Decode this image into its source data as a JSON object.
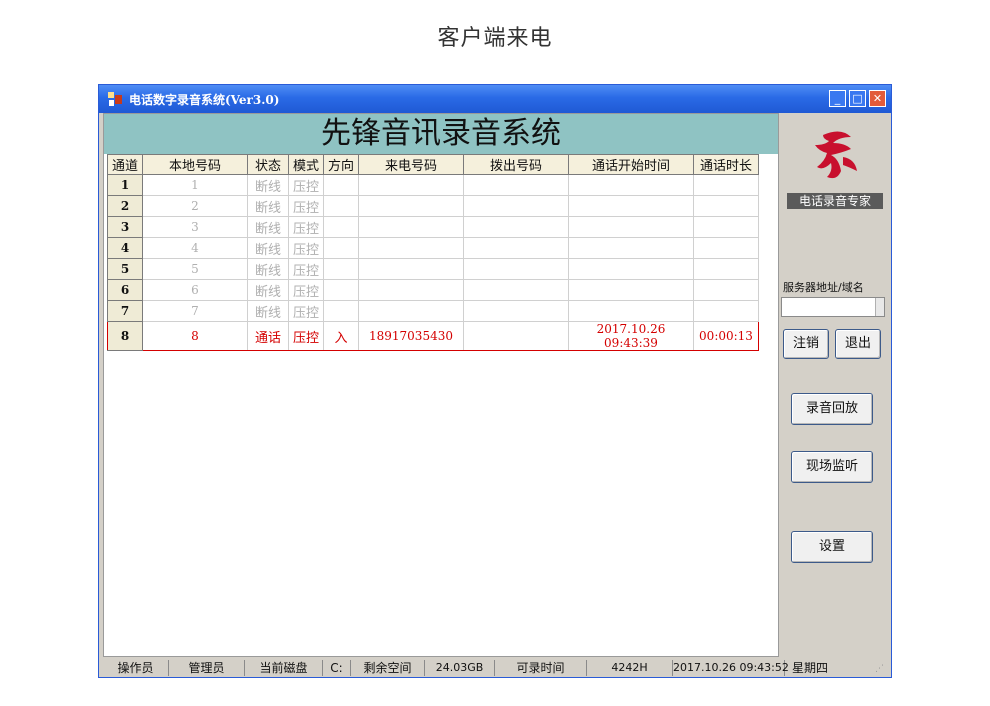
{
  "caption": "客户端来电",
  "window": {
    "title": "电话数字录音系统(Ver3.0)",
    "controls": {
      "minimize": "_",
      "maximize": "□",
      "close": "✕"
    }
  },
  "banner": "先锋音讯录音系统",
  "table": {
    "headers": [
      "通道",
      "本地号码",
      "状态",
      "模式",
      "方向",
      "来电号码",
      "拨出号码",
      "通话开始时间",
      "通话时长"
    ],
    "rows": [
      {
        "channel": "1",
        "local": "1",
        "status": "断线",
        "mode": "压控",
        "direction": "",
        "incoming": "",
        "outgoing": "",
        "start": "",
        "duration": ""
      },
      {
        "channel": "2",
        "local": "2",
        "status": "断线",
        "mode": "压控",
        "direction": "",
        "incoming": "",
        "outgoing": "",
        "start": "",
        "duration": ""
      },
      {
        "channel": "3",
        "local": "3",
        "status": "断线",
        "mode": "压控",
        "direction": "",
        "incoming": "",
        "outgoing": "",
        "start": "",
        "duration": ""
      },
      {
        "channel": "4",
        "local": "4",
        "status": "断线",
        "mode": "压控",
        "direction": "",
        "incoming": "",
        "outgoing": "",
        "start": "",
        "duration": ""
      },
      {
        "channel": "5",
        "local": "5",
        "status": "断线",
        "mode": "压控",
        "direction": "",
        "incoming": "",
        "outgoing": "",
        "start": "",
        "duration": ""
      },
      {
        "channel": "6",
        "local": "6",
        "status": "断线",
        "mode": "压控",
        "direction": "",
        "incoming": "",
        "outgoing": "",
        "start": "",
        "duration": ""
      },
      {
        "channel": "7",
        "local": "7",
        "status": "断线",
        "mode": "压控",
        "direction": "",
        "incoming": "",
        "outgoing": "",
        "start": "",
        "duration": ""
      },
      {
        "channel": "8",
        "local": "8",
        "status": "通话",
        "mode": "压控",
        "direction": "入",
        "incoming": "18917035430",
        "outgoing": "",
        "start": "2017.10.26 09:43:39",
        "duration": "00:00:13"
      }
    ],
    "active_row_color": "#d40000"
  },
  "side": {
    "logo_icon": "red-calligraphy-logo-icon",
    "brand": "电话录音专家",
    "server_label": "服务器地址/域名",
    "server_value": "",
    "logout_label": "注销",
    "exit_label": "退出",
    "playback_label": "录音回放",
    "monitor_label": "现场监听",
    "settings_label": "设置"
  },
  "status": {
    "operator_label": "操作员",
    "operator_value": "管理员",
    "disk_label": "当前磁盘",
    "disk_value": "C:",
    "free_label": "剩余空间",
    "free_value": "24.03GB",
    "rec_label": "可录时间",
    "rec_value": "4242H",
    "datetime": "2017.10.26  09:43:52",
    "weekday": "星期四"
  },
  "colors": {
    "titlebar": "#2a6ae6",
    "banner": "#8fc3c3",
    "window_bg": "#d4d0c8"
  }
}
